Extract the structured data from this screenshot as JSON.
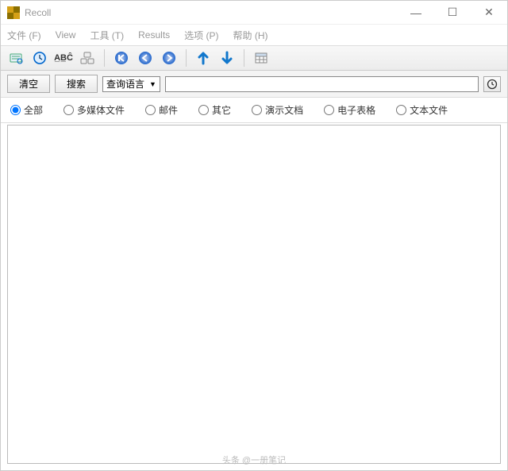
{
  "window": {
    "title": "Recoll"
  },
  "menu": {
    "file": "文件 (F)",
    "view": "View",
    "tools": "工具 (T)",
    "results": "Results",
    "options": "选项 (P)",
    "help": "帮助 (H)"
  },
  "searchbar": {
    "clear": "清空",
    "search": "搜索",
    "query_lang": "查询语言",
    "input_value": ""
  },
  "filters": {
    "all": "全部",
    "media": "多媒体文件",
    "mail": "邮件",
    "other": "其它",
    "presentation": "演示文档",
    "spreadsheet": "电子表格",
    "text": "文本文件",
    "selected": "all"
  },
  "watermark": "头条 @一册笔记"
}
